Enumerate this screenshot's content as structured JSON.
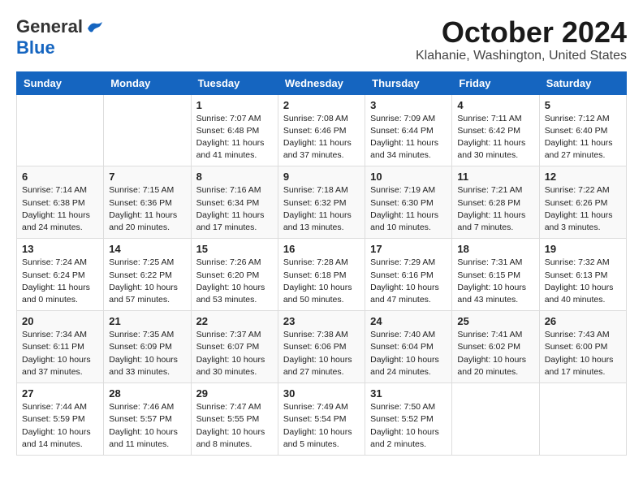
{
  "header": {
    "logo_line1": "General",
    "logo_line2": "Blue",
    "title": "October 2024",
    "subtitle": "Klahanie, Washington, United States"
  },
  "weekdays": [
    "Sunday",
    "Monday",
    "Tuesday",
    "Wednesday",
    "Thursday",
    "Friday",
    "Saturday"
  ],
  "weeks": [
    [
      {
        "day": "",
        "info": ""
      },
      {
        "day": "",
        "info": ""
      },
      {
        "day": "1",
        "info": "Sunrise: 7:07 AM\nSunset: 6:48 PM\nDaylight: 11 hours\nand 41 minutes."
      },
      {
        "day": "2",
        "info": "Sunrise: 7:08 AM\nSunset: 6:46 PM\nDaylight: 11 hours\nand 37 minutes."
      },
      {
        "day": "3",
        "info": "Sunrise: 7:09 AM\nSunset: 6:44 PM\nDaylight: 11 hours\nand 34 minutes."
      },
      {
        "day": "4",
        "info": "Sunrise: 7:11 AM\nSunset: 6:42 PM\nDaylight: 11 hours\nand 30 minutes."
      },
      {
        "day": "5",
        "info": "Sunrise: 7:12 AM\nSunset: 6:40 PM\nDaylight: 11 hours\nand 27 minutes."
      }
    ],
    [
      {
        "day": "6",
        "info": "Sunrise: 7:14 AM\nSunset: 6:38 PM\nDaylight: 11 hours\nand 24 minutes."
      },
      {
        "day": "7",
        "info": "Sunrise: 7:15 AM\nSunset: 6:36 PM\nDaylight: 11 hours\nand 20 minutes."
      },
      {
        "day": "8",
        "info": "Sunrise: 7:16 AM\nSunset: 6:34 PM\nDaylight: 11 hours\nand 17 minutes."
      },
      {
        "day": "9",
        "info": "Sunrise: 7:18 AM\nSunset: 6:32 PM\nDaylight: 11 hours\nand 13 minutes."
      },
      {
        "day": "10",
        "info": "Sunrise: 7:19 AM\nSunset: 6:30 PM\nDaylight: 11 hours\nand 10 minutes."
      },
      {
        "day": "11",
        "info": "Sunrise: 7:21 AM\nSunset: 6:28 PM\nDaylight: 11 hours\nand 7 minutes."
      },
      {
        "day": "12",
        "info": "Sunrise: 7:22 AM\nSunset: 6:26 PM\nDaylight: 11 hours\nand 3 minutes."
      }
    ],
    [
      {
        "day": "13",
        "info": "Sunrise: 7:24 AM\nSunset: 6:24 PM\nDaylight: 11 hours\nand 0 minutes."
      },
      {
        "day": "14",
        "info": "Sunrise: 7:25 AM\nSunset: 6:22 PM\nDaylight: 10 hours\nand 57 minutes."
      },
      {
        "day": "15",
        "info": "Sunrise: 7:26 AM\nSunset: 6:20 PM\nDaylight: 10 hours\nand 53 minutes."
      },
      {
        "day": "16",
        "info": "Sunrise: 7:28 AM\nSunset: 6:18 PM\nDaylight: 10 hours\nand 50 minutes."
      },
      {
        "day": "17",
        "info": "Sunrise: 7:29 AM\nSunset: 6:16 PM\nDaylight: 10 hours\nand 47 minutes."
      },
      {
        "day": "18",
        "info": "Sunrise: 7:31 AM\nSunset: 6:15 PM\nDaylight: 10 hours\nand 43 minutes."
      },
      {
        "day": "19",
        "info": "Sunrise: 7:32 AM\nSunset: 6:13 PM\nDaylight: 10 hours\nand 40 minutes."
      }
    ],
    [
      {
        "day": "20",
        "info": "Sunrise: 7:34 AM\nSunset: 6:11 PM\nDaylight: 10 hours\nand 37 minutes."
      },
      {
        "day": "21",
        "info": "Sunrise: 7:35 AM\nSunset: 6:09 PM\nDaylight: 10 hours\nand 33 minutes."
      },
      {
        "day": "22",
        "info": "Sunrise: 7:37 AM\nSunset: 6:07 PM\nDaylight: 10 hours\nand 30 minutes."
      },
      {
        "day": "23",
        "info": "Sunrise: 7:38 AM\nSunset: 6:06 PM\nDaylight: 10 hours\nand 27 minutes."
      },
      {
        "day": "24",
        "info": "Sunrise: 7:40 AM\nSunset: 6:04 PM\nDaylight: 10 hours\nand 24 minutes."
      },
      {
        "day": "25",
        "info": "Sunrise: 7:41 AM\nSunset: 6:02 PM\nDaylight: 10 hours\nand 20 minutes."
      },
      {
        "day": "26",
        "info": "Sunrise: 7:43 AM\nSunset: 6:00 PM\nDaylight: 10 hours\nand 17 minutes."
      }
    ],
    [
      {
        "day": "27",
        "info": "Sunrise: 7:44 AM\nSunset: 5:59 PM\nDaylight: 10 hours\nand 14 minutes."
      },
      {
        "day": "28",
        "info": "Sunrise: 7:46 AM\nSunset: 5:57 PM\nDaylight: 10 hours\nand 11 minutes."
      },
      {
        "day": "29",
        "info": "Sunrise: 7:47 AM\nSunset: 5:55 PM\nDaylight: 10 hours\nand 8 minutes."
      },
      {
        "day": "30",
        "info": "Sunrise: 7:49 AM\nSunset: 5:54 PM\nDaylight: 10 hours\nand 5 minutes."
      },
      {
        "day": "31",
        "info": "Sunrise: 7:50 AM\nSunset: 5:52 PM\nDaylight: 10 hours\nand 2 minutes."
      },
      {
        "day": "",
        "info": ""
      },
      {
        "day": "",
        "info": ""
      }
    ]
  ]
}
